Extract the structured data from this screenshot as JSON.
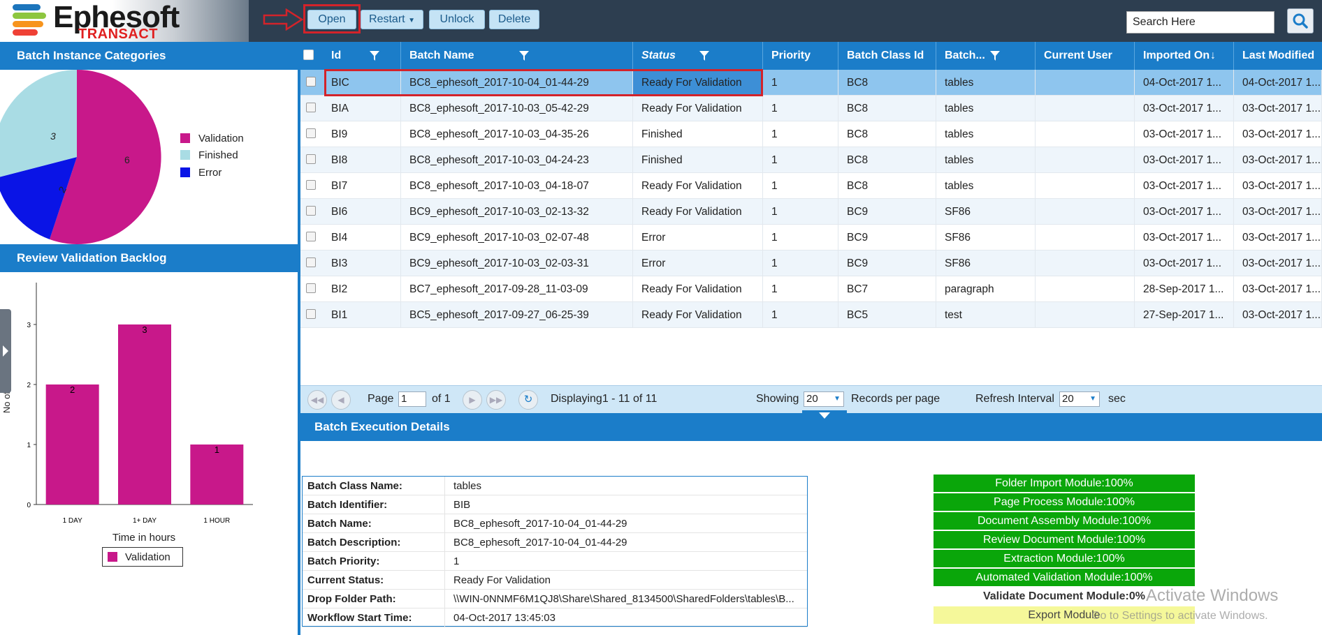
{
  "app": {
    "logo_main": "Ephesoft",
    "logo_sub": "TRANSACT",
    "brand_colors": {
      "header": "#2d3e50",
      "accent": "#1b7dc9",
      "highlight": "#d3232a"
    }
  },
  "toolbar": {
    "open_label": "Open",
    "restart_label": "Restart",
    "unlock_label": "Unlock",
    "delete_label": "Delete",
    "search_placeholder": "Search Here",
    "icons": [
      "red-arrow-annotation",
      "search-icon",
      "chevron-down-icon"
    ]
  },
  "categories_panel": {
    "title": "Batch Instance Categories",
    "pie": [
      {
        "name": "Validation",
        "value": 6,
        "color": "#c8188a"
      },
      {
        "name": "Finished",
        "value": 3,
        "color": "#a9dce4"
      },
      {
        "name": "Error",
        "value": 2,
        "color": "#0a14e6"
      }
    ]
  },
  "backlog_panel": {
    "title": "Review Validation Backlog",
    "ylabel": "No of batches",
    "xlabel": "Time in hours",
    "legend": "Validation",
    "yticks": [
      "0",
      "1",
      "2",
      "3"
    ]
  },
  "chart_data": {
    "type": "bar",
    "categories": [
      "1 DAY",
      "1+ DAY",
      "1 HOUR"
    ],
    "values": [
      2,
      3,
      1
    ],
    "series": [
      {
        "name": "Validation",
        "values": [
          2,
          3,
          1
        ]
      }
    ],
    "xlabel": "Time in hours",
    "ylabel": "No of batches",
    "ylim": [
      0,
      3
    ],
    "legend_position": "bottom"
  },
  "grid": {
    "columns": [
      "Id",
      "Batch Name",
      "Status",
      "Priority",
      "Batch Class Id",
      "Batch...",
      "Current User",
      "Imported On",
      "Last Modified"
    ],
    "rows": [
      [
        "BIC",
        "BC8_ephesoft_2017-10-04_01-44-29",
        "Ready For Validation",
        "1",
        "BC8",
        "tables",
        "",
        "04-Oct-2017 1...",
        "04-Oct-2017 1..."
      ],
      [
        "BIA",
        "BC8_ephesoft_2017-10-03_05-42-29",
        "Ready For Validation",
        "1",
        "BC8",
        "tables",
        "",
        "03-Oct-2017 1...",
        "03-Oct-2017 1..."
      ],
      [
        "BI9",
        "BC8_ephesoft_2017-10-03_04-35-26",
        "Finished",
        "1",
        "BC8",
        "tables",
        "",
        "03-Oct-2017 1...",
        "03-Oct-2017 1..."
      ],
      [
        "BI8",
        "BC8_ephesoft_2017-10-03_04-24-23",
        "Finished",
        "1",
        "BC8",
        "tables",
        "",
        "03-Oct-2017 1...",
        "03-Oct-2017 1..."
      ],
      [
        "BI7",
        "BC8_ephesoft_2017-10-03_04-18-07",
        "Ready For Validation",
        "1",
        "BC8",
        "tables",
        "",
        "03-Oct-2017 1...",
        "03-Oct-2017 1..."
      ],
      [
        "BI6",
        "BC9_ephesoft_2017-10-03_02-13-32",
        "Ready For Validation",
        "1",
        "BC9",
        "SF86",
        "",
        "03-Oct-2017 1...",
        "03-Oct-2017 1..."
      ],
      [
        "BI4",
        "BC9_ephesoft_2017-10-03_02-07-48",
        "Error",
        "1",
        "BC9",
        "SF86",
        "",
        "03-Oct-2017 1...",
        "03-Oct-2017 1..."
      ],
      [
        "BI3",
        "BC9_ephesoft_2017-10-03_02-03-31",
        "Error",
        "1",
        "BC9",
        "SF86",
        "",
        "03-Oct-2017 1...",
        "03-Oct-2017 1..."
      ],
      [
        "BI2",
        "BC7_ephesoft_2017-09-28_11-03-09",
        "Ready For Validation",
        "1",
        "BC7",
        "paragraph",
        "",
        "28-Sep-2017 1...",
        "03-Oct-2017 1..."
      ],
      [
        "BI1",
        "BC5_ephesoft_2017-09-27_06-25-39",
        "Ready For Validation",
        "1",
        "BC5",
        "test",
        "",
        "27-Sep-2017 1...",
        "03-Oct-2017 1..."
      ]
    ],
    "selected_row": 0
  },
  "pager": {
    "page_label": "Page",
    "page_value": "1",
    "of_label": "of 1",
    "displaying": "Displaying1 - 11 of 11",
    "showing_label": "Showing",
    "showing_value": "20",
    "records_label": "Records per page",
    "refresh_label": "Refresh Interval",
    "refresh_value": "20",
    "sec_label": "sec"
  },
  "execution": {
    "title": "Batch Execution Details",
    "details": [
      {
        "key": "Batch Class Name:",
        "value": "tables"
      },
      {
        "key": "Batch Identifier:",
        "value": "BIB"
      },
      {
        "key": "Batch Name:",
        "value": "BC8_ephesoft_2017-10-04_01-44-29"
      },
      {
        "key": "Batch Description:",
        "value": "BC8_ephesoft_2017-10-04_01-44-29"
      },
      {
        "key": "Batch Priority:",
        "value": "1"
      },
      {
        "key": "Current Status:",
        "value": "Ready For Validation"
      },
      {
        "key": "Drop Folder Path:",
        "value": "\\\\WIN-0NNMF6M1QJ8\\Share\\Shared_8134500\\SharedFolders\\tables\\B..."
      },
      {
        "key": "Workflow Start Time:",
        "value": "04-Oct-2017 13:45:03"
      }
    ],
    "modules": [
      {
        "label": "Folder Import Module:100%",
        "state": "done"
      },
      {
        "label": "Page Process Module:100%",
        "state": "done"
      },
      {
        "label": "Document Assembly Module:100%",
        "state": "done"
      },
      {
        "label": "Review Document Module:100%",
        "state": "done"
      },
      {
        "label": "Extraction Module:100%",
        "state": "done"
      },
      {
        "label": "Automated Validation Module:100%",
        "state": "done"
      },
      {
        "label": "Validate Document Module:0%",
        "state": "pending"
      },
      {
        "label": "Export Module",
        "state": "export"
      }
    ]
  },
  "watermark": {
    "line1": "Activate Windows",
    "line2": "Go to Settings to activate Windows."
  }
}
